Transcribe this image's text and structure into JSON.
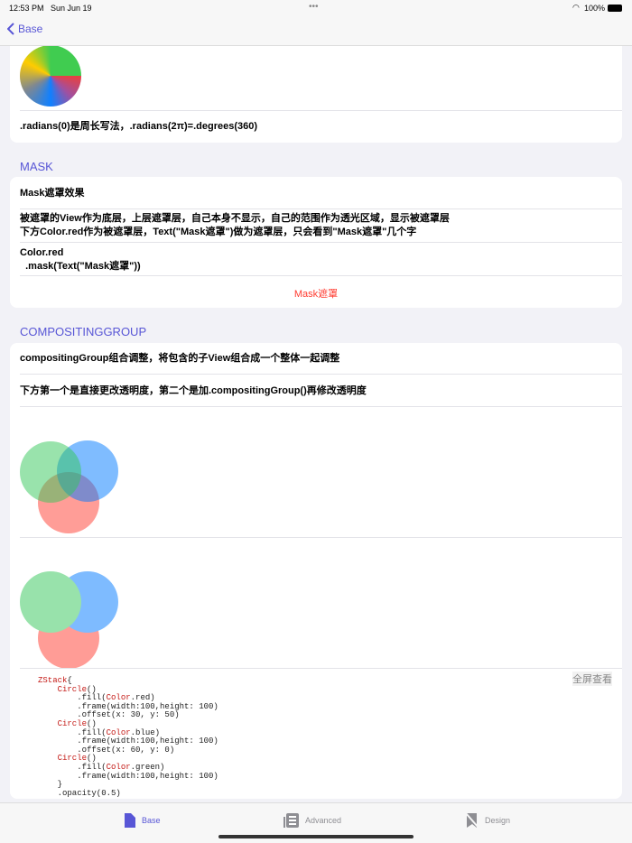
{
  "status": {
    "time": "12:53 PM",
    "date": "Sun Jun 19",
    "battery": "100%"
  },
  "nav": {
    "back_label": "Base"
  },
  "angular": {
    "caption": ".radians(0)是周长写法，.radians(2π)=.degrees(360)"
  },
  "mask": {
    "header": "MASK",
    "title": "Mask遮罩效果",
    "desc1": "被遮罩的View作为底层，上层遮罩层，自己本身不显示，自己的范围作为透光区域，显示被遮罩层",
    "desc2": "下方Color.red作为被遮罩层，Text(\"Mask遮罩\")做为遮罩层，只会看到\"Mask遮罩\"几个字",
    "code1": "Color.red",
    "code2": "  .mask(Text(\"Mask遮罩\"))",
    "result": "Mask遮罩",
    "result_color": "#ff3b30"
  },
  "compositing": {
    "header": "COMPOSITINGGROUP",
    "title": "compositingGroup组合调整，将包含的子View组合成一个整体一起调整",
    "desc": "下方第一个是直接更改透明度，第二个是加.compositingGroup()再修改透明度",
    "fullscreen": "全屏查看",
    "code": [
      [
        [
          "kw",
          "ZStack"
        ],
        [
          "",
          "{"
        ]
      ],
      [
        [
          "",
          "    "
        ],
        [
          "kw",
          "Circle"
        ],
        [
          "",
          "()"
        ]
      ],
      [
        [
          "",
          "        .fill("
        ],
        [
          "kw",
          "Color"
        ],
        [
          "",
          ".red)"
        ]
      ],
      [
        [
          "",
          "        .frame(width:100,height: 100)"
        ]
      ],
      [
        [
          "",
          "        .offset(x: 30, y: 50)"
        ]
      ],
      [
        [
          "",
          "    "
        ],
        [
          "kw",
          "Circle"
        ],
        [
          "",
          "()"
        ]
      ],
      [
        [
          "",
          "        .fill("
        ],
        [
          "kw",
          "Color"
        ],
        [
          "",
          ".blue)"
        ]
      ],
      [
        [
          "",
          "        .frame(width:100,height: 100)"
        ]
      ],
      [
        [
          "",
          "        .offset(x: 60, y: 0)"
        ]
      ],
      [
        [
          "",
          "    "
        ],
        [
          "kw",
          "Circle"
        ],
        [
          "",
          "()"
        ]
      ],
      [
        [
          "",
          "        .fill("
        ],
        [
          "kw",
          "Color"
        ],
        [
          "",
          ".green)"
        ]
      ],
      [
        [
          "",
          "        .frame(width:100,height: 100)"
        ]
      ],
      [
        [
          "",
          "    }"
        ]
      ],
      [
        [
          "",
          "    .opacity(0.5)"
        ]
      ]
    ]
  },
  "tabs": [
    {
      "label": "Base",
      "active": true
    },
    {
      "label": "Advanced",
      "active": false
    },
    {
      "label": "Design",
      "active": false
    }
  ],
  "accent": "#5856d6"
}
